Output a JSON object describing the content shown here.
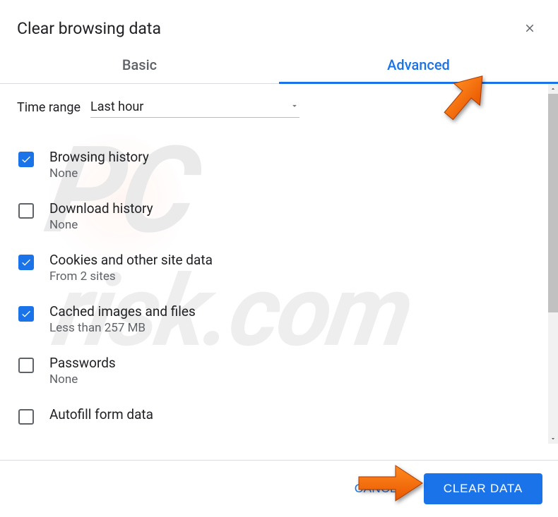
{
  "header": {
    "title": "Clear browsing data"
  },
  "tabs": {
    "basic": "Basic",
    "advanced": "Advanced"
  },
  "time_range": {
    "label": "Time range",
    "selected": "Last hour"
  },
  "items": [
    {
      "checked": true,
      "title": "Browsing history",
      "sub": "None"
    },
    {
      "checked": false,
      "title": "Download history",
      "sub": "None"
    },
    {
      "checked": true,
      "title": "Cookies and other site data",
      "sub": "From 2 sites"
    },
    {
      "checked": true,
      "title": "Cached images and files",
      "sub": "Less than 257 MB"
    },
    {
      "checked": false,
      "title": "Passwords",
      "sub": "None"
    },
    {
      "checked": false,
      "title": "Autofill form data",
      "sub": ""
    }
  ],
  "footer": {
    "cancel": "CANCEL",
    "clear": "CLEAR DATA"
  },
  "watermark": {
    "line1": "PC",
    "line2": "risk.com"
  }
}
